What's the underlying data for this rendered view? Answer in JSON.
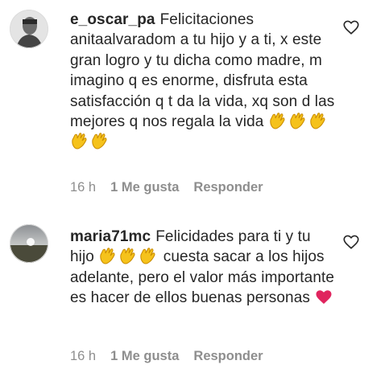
{
  "comments": [
    {
      "username": "e_oscar_pa",
      "text": "Felicitaciones anitaalvaradom a tu hijo y a ti, x este gran logro y tu dicha como madre, m imagino q es enorme, disfruta esta satisfacción q t da la vida, xq son d las mejores q nos regala la vida",
      "emoji": "clapping-hands x5",
      "time": "16 h",
      "likes": "1 Me gusta",
      "reply": "Responder"
    },
    {
      "username": "maria71mc",
      "text_part1": "Felicidades para ti y tu hijo",
      "emoji_mid": "clapping-hands x3",
      "text_part2": "cuesta sacar a los hijos adelante, pero el valor más importante es hacer de ellos buenas personas",
      "emoji_end": "red-heart",
      "time": "16 h",
      "likes": "1 Me gusta",
      "reply": "Responder"
    }
  ],
  "colors": {
    "text": "#262626",
    "meta": "#8e8e8e",
    "heart": "#e0245e",
    "clap": "#f5c21b"
  },
  "icons": {
    "like": "heart-outline-icon",
    "clap": "clapping-hands-icon",
    "heart": "red-heart-icon"
  }
}
